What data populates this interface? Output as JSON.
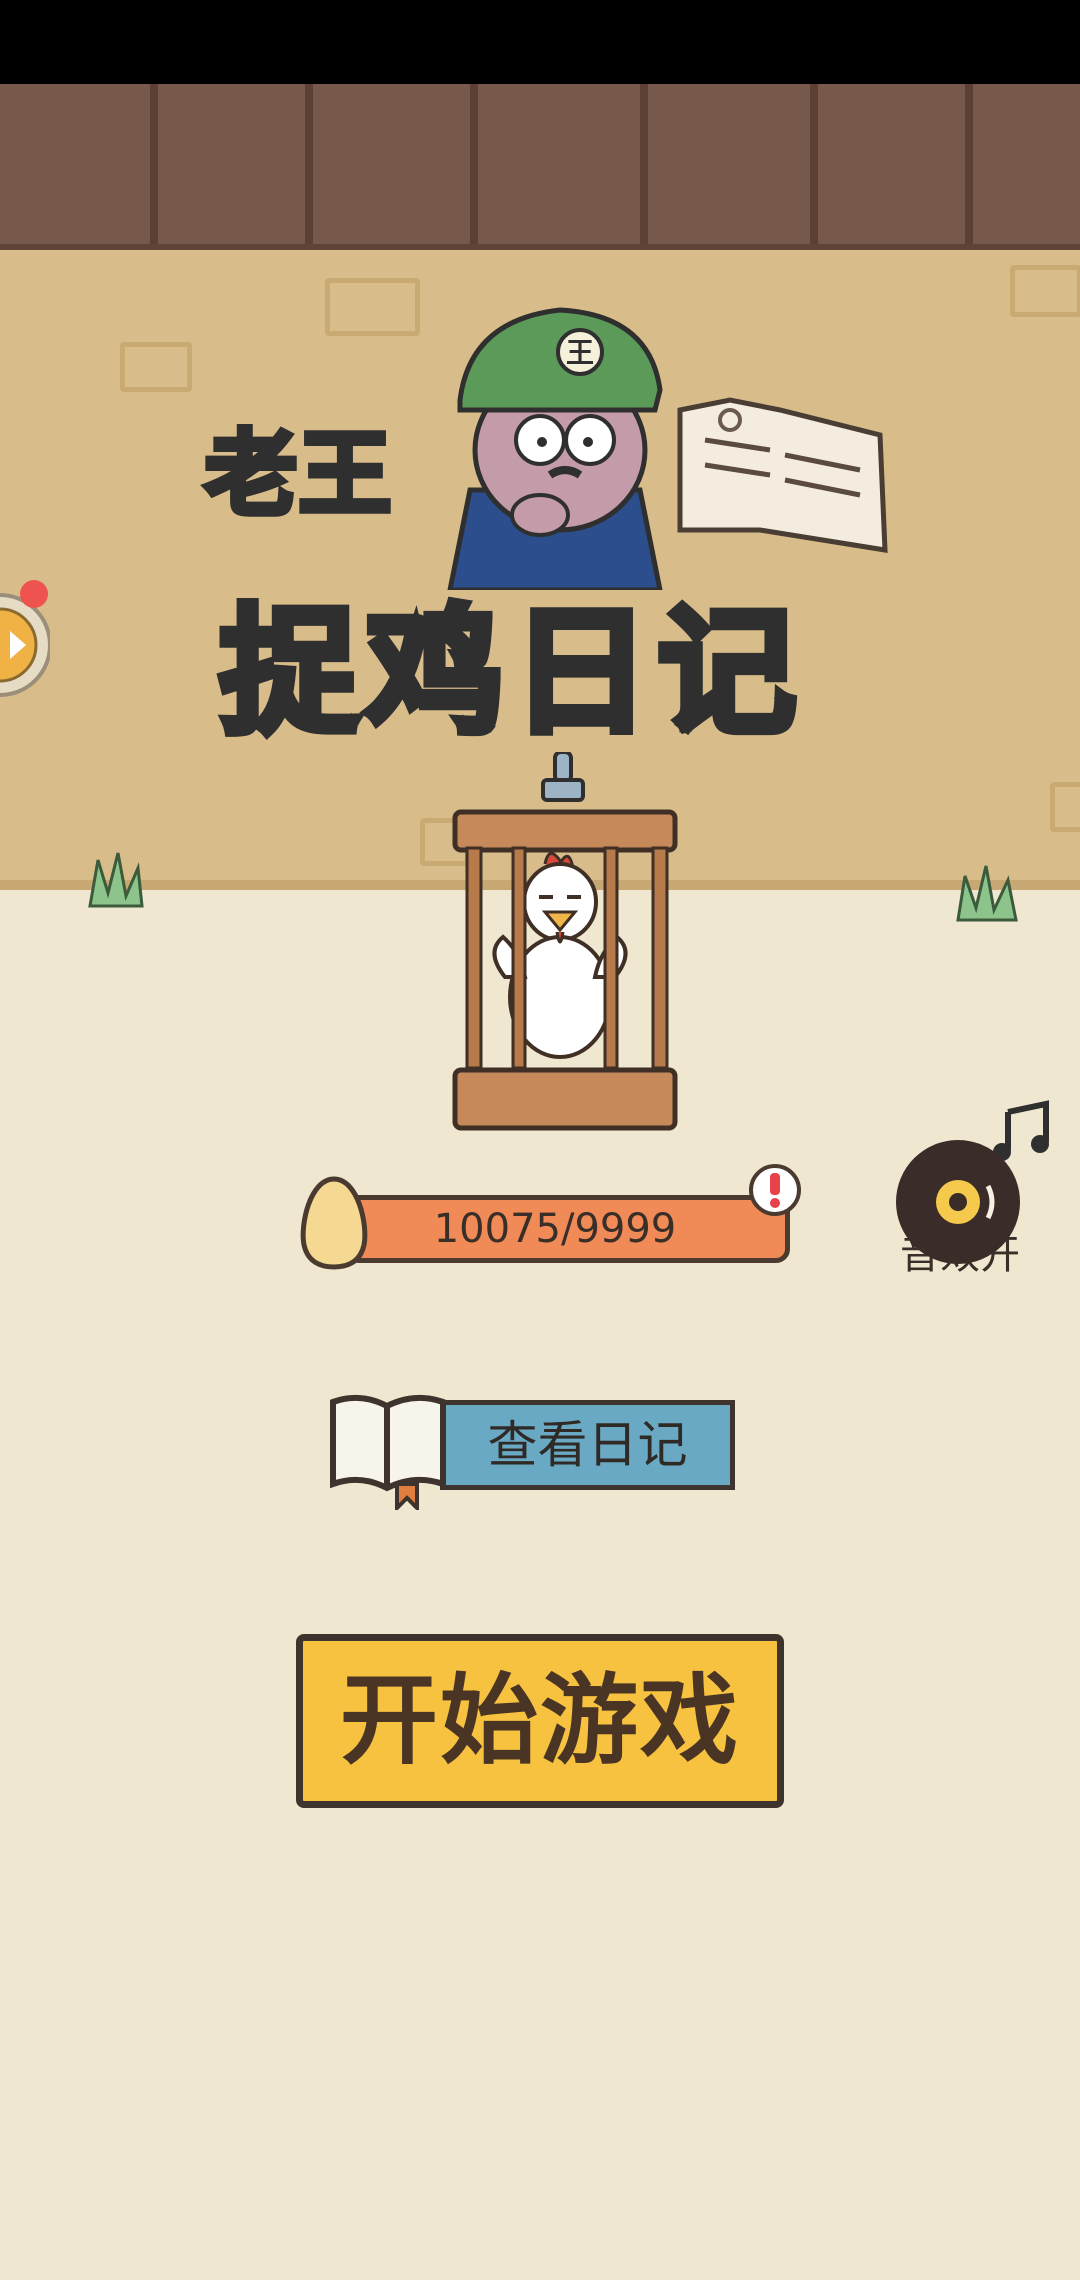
{
  "title": {
    "line1": "老王",
    "line2": "捉鸡日记"
  },
  "egg_progress": {
    "text": "10075/9999",
    "current": 10075,
    "target": 9999,
    "alert": true
  },
  "sound": {
    "label": "音效开",
    "on": true
  },
  "buttons": {
    "diary": "查看日记",
    "start": "开始游戏"
  },
  "colors": {
    "start_button": "#f6c23f",
    "diary_button": "#69a9c4",
    "egg_bar": "#f08a57",
    "title_green": "#6dd6a0"
  }
}
